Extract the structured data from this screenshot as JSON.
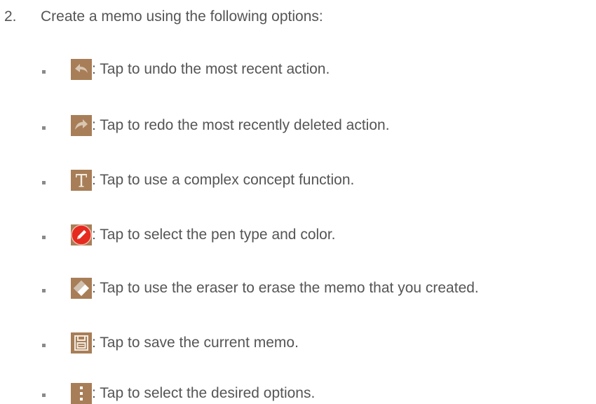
{
  "step": {
    "number": "2.",
    "text": "Create a memo using the following options:"
  },
  "options": [
    {
      "icon": "undo-icon",
      "text": ": Tap to undo the most recent action."
    },
    {
      "icon": "redo-icon",
      "text": ": Tap to redo the most recently deleted action."
    },
    {
      "icon": "text-icon",
      "text": ": Tap to use a complex concept function."
    },
    {
      "icon": "pen-icon",
      "text": ": Tap to select the pen type and color."
    },
    {
      "icon": "eraser-icon",
      "text": ": Tap to use the eraser to erase the memo that you created."
    },
    {
      "icon": "save-icon",
      "text": ": Tap to save the current memo."
    },
    {
      "icon": "more-options-icon",
      "text": ": Tap to select the desired options."
    }
  ],
  "colors": {
    "icon_background": "#a87e58",
    "pen_red": "#e52a1f",
    "text": "#555555",
    "bullet": "#8a8a8a"
  }
}
